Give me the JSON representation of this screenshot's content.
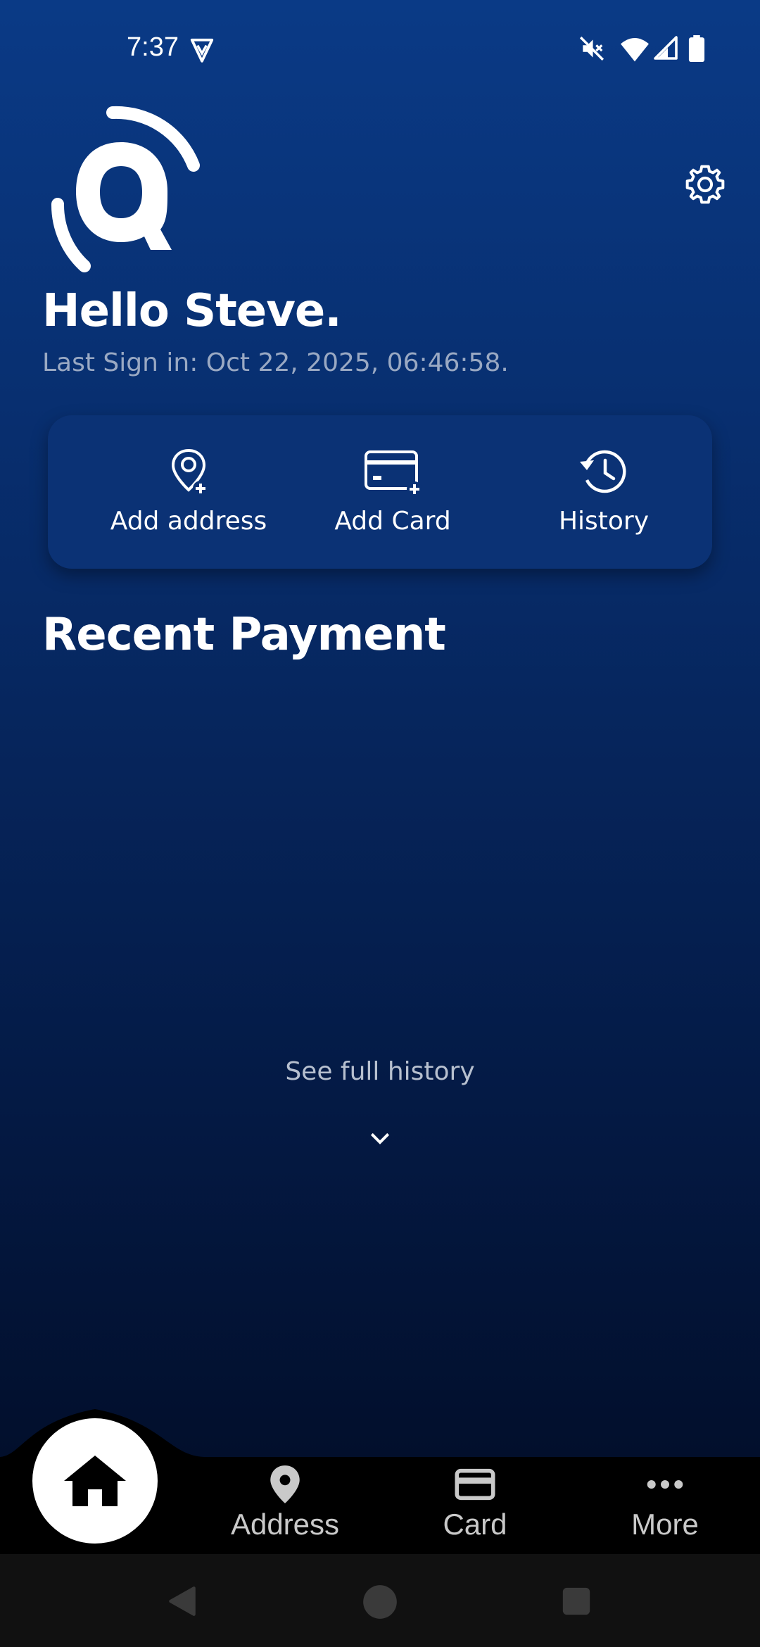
{
  "status_bar": {
    "time": "7:37",
    "icons": [
      "vpn-shield-icon",
      "mute-icon",
      "wifi-icon",
      "signal-icon",
      "battery-icon"
    ]
  },
  "header": {
    "logo_icon": "q-logo-icon",
    "settings_icon": "gear-icon",
    "greeting": "Hello Steve.",
    "last_sign_in": "Last Sign in: Oct 22, 2025, 06:46:58."
  },
  "quick_actions": [
    {
      "label": "Add address",
      "icon": "add-location-icon"
    },
    {
      "label": "Add Card",
      "icon": "add-card-icon"
    },
    {
      "label": "History",
      "icon": "history-icon"
    }
  ],
  "recent": {
    "title": "Recent Payment",
    "see_full": "See full history",
    "chevron_icon": "chevron-down-icon"
  },
  "bottom_nav": {
    "home_icon": "home-icon",
    "items": [
      {
        "label": "Address",
        "icon": "location-pin-icon"
      },
      {
        "label": "Card",
        "icon": "card-icon"
      },
      {
        "label": "More",
        "icon": "more-dots-icon"
      }
    ]
  },
  "system_nav": [
    "back-icon",
    "home-circle-icon",
    "recents-square-icon"
  ],
  "colors": {
    "gradient_top": "#0a3a86",
    "gradient_bottom": "#020f2c",
    "card_bg": "#0b3275",
    "muted_text": "#9aa9c3"
  }
}
